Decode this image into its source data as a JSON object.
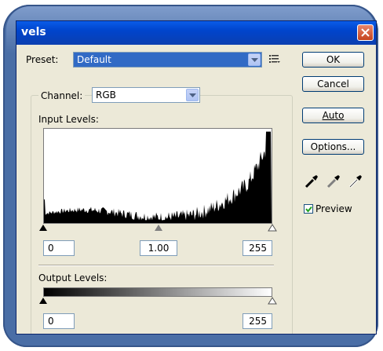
{
  "window": {
    "title": "vels"
  },
  "preset": {
    "label": "Preset:",
    "value": "Default"
  },
  "channel": {
    "label": "Channel:",
    "value": "RGB"
  },
  "input_levels": {
    "label": "Input Levels:",
    "black": "0",
    "gamma": "1.00",
    "white": "255"
  },
  "output_levels": {
    "label": "Output Levels:",
    "black": "0",
    "white": "255"
  },
  "buttons": {
    "ok": "OK",
    "cancel": "Cancel",
    "auto": "Auto",
    "options": "Options..."
  },
  "preview": {
    "label": "Preview",
    "checked": true
  },
  "colors": {
    "title_bar": "#0a5ce8",
    "frame": "#4a6ea6",
    "dialog_bg": "#ece9d8",
    "selection": "#316ac5"
  },
  "icons": [
    "close-icon",
    "chevron-down-icon",
    "list-menu-icon",
    "black-eyedropper-icon",
    "gray-eyedropper-icon",
    "white-eyedropper-icon",
    "checkmark-icon"
  ]
}
